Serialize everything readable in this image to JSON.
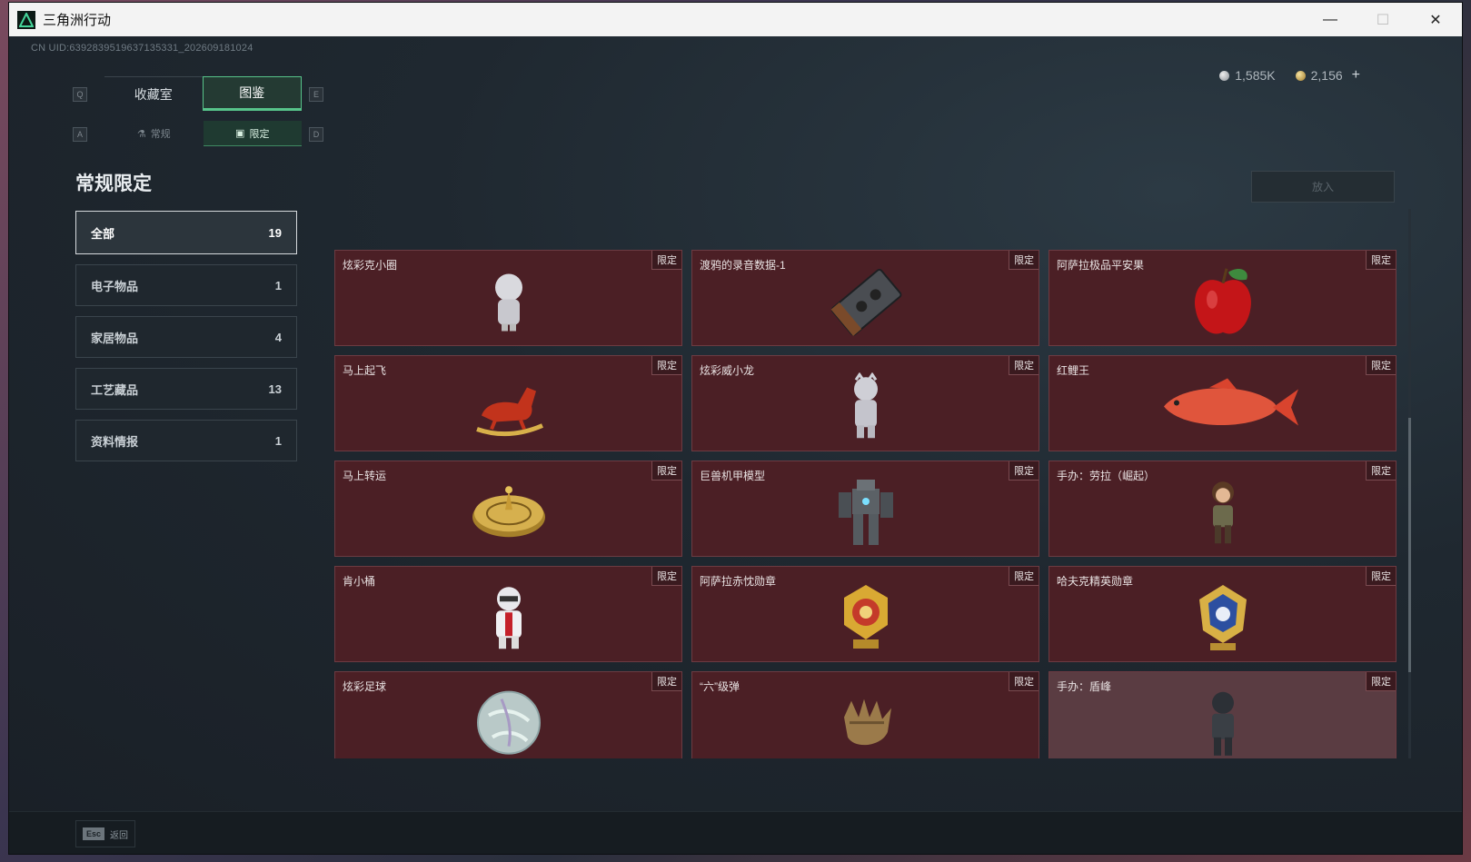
{
  "window": {
    "title": "三角洲行动",
    "controls": {
      "minimize": "—",
      "maximize": "☐",
      "close": "✕"
    }
  },
  "uid": "CN UID:6392839519637135331_202609181024",
  "currency": [
    {
      "icon": "silver-coin-icon",
      "value": "1,585K"
    },
    {
      "icon": "gold-coin-icon",
      "value": "2,156"
    }
  ],
  "currency_plus": "+",
  "key_hints": {
    "prev_tab": "Q",
    "next_tab": "E",
    "prev_sub": "A",
    "next_sub": "D"
  },
  "tabs": [
    {
      "label": "收藏室",
      "active": false
    },
    {
      "label": "图鉴",
      "active": true
    }
  ],
  "subtabs": [
    {
      "label": "常规",
      "icon": "flask-icon",
      "active": false
    },
    {
      "label": "限定",
      "icon": "image-frame-icon",
      "active": true
    }
  ],
  "section_title": "常规限定",
  "categories": [
    {
      "label": "全部",
      "count": "19",
      "active": true
    },
    {
      "label": "电子物品",
      "count": "1"
    },
    {
      "label": "家居物品",
      "count": "4"
    },
    {
      "label": "工艺藏品",
      "count": "13"
    },
    {
      "label": "资料情报",
      "count": "1"
    }
  ],
  "put_button": "放入",
  "items": [
    {
      "name": "炫彩克小圈",
      "badge": "限定",
      "icon": "figurine-icon"
    },
    {
      "name": "渡鸦的录音数据-1",
      "badge": "限定",
      "icon": "cassette-tape-icon"
    },
    {
      "name": "阿萨拉极品平安果",
      "badge": "限定",
      "icon": "apple-icon"
    },
    {
      "name": "马上起飞",
      "badge": "限定",
      "icon": "horse-icon"
    },
    {
      "name": "炫彩威小龙",
      "badge": "限定",
      "icon": "figurine-icon"
    },
    {
      "name": "红鲤王",
      "badge": "限定",
      "icon": "carp-icon"
    },
    {
      "name": "马上转运",
      "badge": "限定",
      "icon": "roulette-icon"
    },
    {
      "name": "巨兽机甲模型",
      "badge": "限定",
      "icon": "mech-icon"
    },
    {
      "name": "手办：劳拉（崛起）",
      "badge": "限定",
      "icon": "figurine-icon"
    },
    {
      "name": "肯小桶",
      "badge": "限定",
      "icon": "figurine-icon"
    },
    {
      "name": "阿萨拉赤忱勋章",
      "badge": "限定",
      "icon": "medal-icon"
    },
    {
      "name": "哈夫克精英勋章",
      "badge": "限定",
      "icon": "medal-icon"
    },
    {
      "name": "炫彩足球",
      "badge": "限定",
      "icon": "soccer-ball-icon"
    },
    {
      "name": "“六”级弹",
      "badge": "限定",
      "icon": "hand-bullets-icon"
    },
    {
      "name": "手办：盾峰",
      "badge": "限定",
      "icon": "figurine-icon"
    }
  ],
  "back": {
    "key": "Esc",
    "label": "返回"
  },
  "colors": {
    "accent": "#57c48a",
    "card_bg": "#4b1f25",
    "window_bg": "#1b2229"
  }
}
